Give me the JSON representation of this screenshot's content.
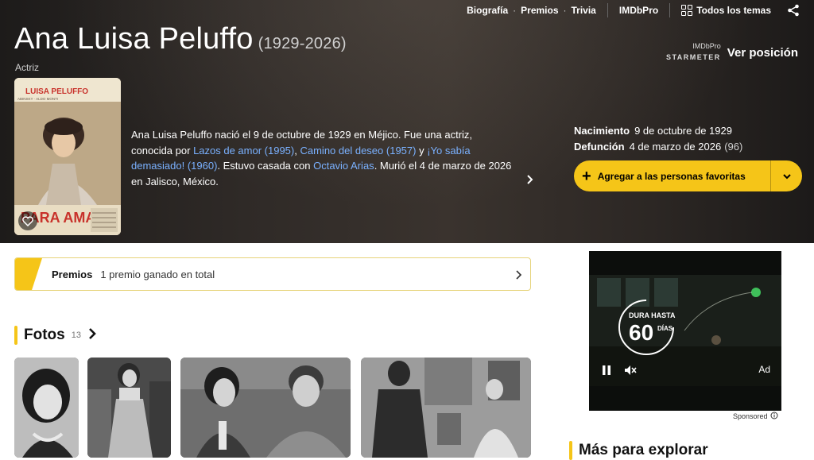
{
  "nav": {
    "links": [
      "Biografía",
      "Premios",
      "Trivia"
    ],
    "imdbpro": "IMDbPro",
    "all_topics": "Todos los temas"
  },
  "person": {
    "name": "Ana Luisa Peluffo",
    "years": "(1929-2026)",
    "role": "Actriz"
  },
  "starmeter": {
    "pro": "IMDbPro",
    "label": "STARMETER",
    "link": "Ver posición"
  },
  "poster": {
    "top_text": "LUISA PELUFFO",
    "sub_text": "ABINSKY · ALDO MONTI",
    "title_text": "PARA AMAR"
  },
  "bio": {
    "t1": "Ana Luisa Peluffo nació el 9 de octubre de 1929 en Méjico. Fue una actriz, conocida por ",
    "l1": "Lazos de amor (1995)",
    "t2": ", ",
    "l2": "Camino del deseo (1957)",
    "t3": " y ",
    "l3": "¡Yo sabía demasiado! (1960)",
    "t4": ". Estuvo casada con ",
    "l4": "Octavio Arias",
    "t5": ". Murió el 4 de marzo de 2026 en Jalisco, México."
  },
  "facts": {
    "birth_label": "Nacimiento",
    "birth_value": "9 de octubre de 1929",
    "death_label": "Defunción",
    "death_value": "4 de marzo de 2026",
    "death_age": "(96)"
  },
  "favorite_button": "Agregar a las personas favoritas",
  "awards": {
    "label": "Premios",
    "text": "1 premio ganado en total"
  },
  "photos": {
    "title": "Fotos",
    "count": "13"
  },
  "ad": {
    "line1": "DURA HASTA",
    "big": "60",
    "unit": "DÍAS",
    "ad_label": "Ad",
    "sponsored": "Sponsored"
  },
  "more": {
    "title": "Más para explorar"
  },
  "colors": {
    "accent": "#f5c518",
    "link": "#7ab1ff",
    "hero_bg": "#2f2a27"
  }
}
